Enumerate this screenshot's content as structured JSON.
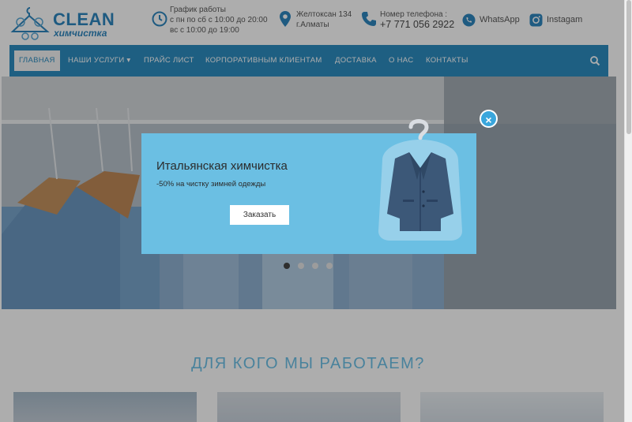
{
  "logo": {
    "main": "CLEAN",
    "sub": "химчистка"
  },
  "header": {
    "hours": {
      "line1": "График работы",
      "line2": "с пн по сб с 10:00 до 20:00",
      "line3": "вс с 10:00 до 19:00",
      "icon": "clock-icon"
    },
    "address": {
      "line1": "Желтоксан 134",
      "line2": "г.Алматы",
      "icon": "map-pin-icon"
    },
    "phone": {
      "label": "Номер телефона :",
      "number": "+7 771 056 2922",
      "icon": "phone-icon"
    },
    "whatsapp": {
      "label": "WhatsApp",
      "icon": "whatsapp-icon"
    },
    "instagram": {
      "label": "Instagam",
      "icon": "instagram-icon"
    }
  },
  "nav": {
    "items": [
      {
        "label": "ГЛАВНАЯ"
      },
      {
        "label": "НАШИ УСЛУГИ ▾"
      },
      {
        "label": "ПРАЙС ЛИСТ"
      },
      {
        "label": "КОРПОРАТИВНЫМ КЛИЕНТАМ"
      },
      {
        "label": "ДОСТАВКА"
      },
      {
        "label": "О НАС"
      },
      {
        "label": "КОНТАКТЫ"
      }
    ],
    "search_icon": "search-icon"
  },
  "popup": {
    "title": "Итальянская химчистка",
    "subtitle": "-50% на чистку зимней одежды",
    "button": "Заказать",
    "close": "×"
  },
  "slider": {
    "slides": 4,
    "active": 1
  },
  "section": {
    "title": "ДЛЯ КОГО МЫ РАБОТАЕМ?"
  },
  "colors": {
    "brand": "#2d8dc0",
    "popup_bg": "#6bbfe3",
    "accent": "#6cc0e6",
    "close": "#3aa6dc"
  }
}
